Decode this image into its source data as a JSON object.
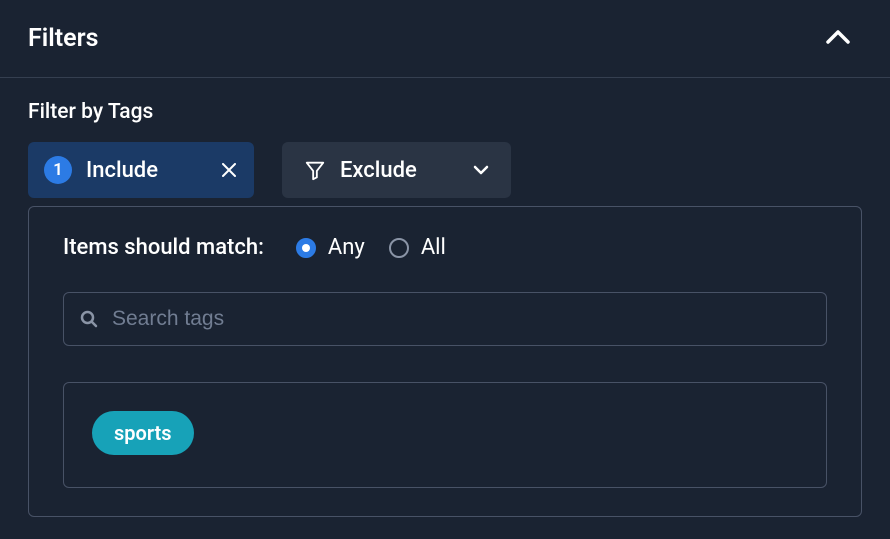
{
  "header": {
    "title": "Filters"
  },
  "section": {
    "label": "Filter by Tags"
  },
  "tabs": {
    "include": {
      "label": "Include",
      "count": "1"
    },
    "exclude": {
      "label": "Exclude"
    }
  },
  "panel": {
    "match_label": "Items should match:",
    "radio_any": "Any",
    "radio_all": "All",
    "selected_radio": "any",
    "search": {
      "placeholder": "Search tags",
      "value": ""
    },
    "selected_tags": [
      "sports"
    ]
  }
}
